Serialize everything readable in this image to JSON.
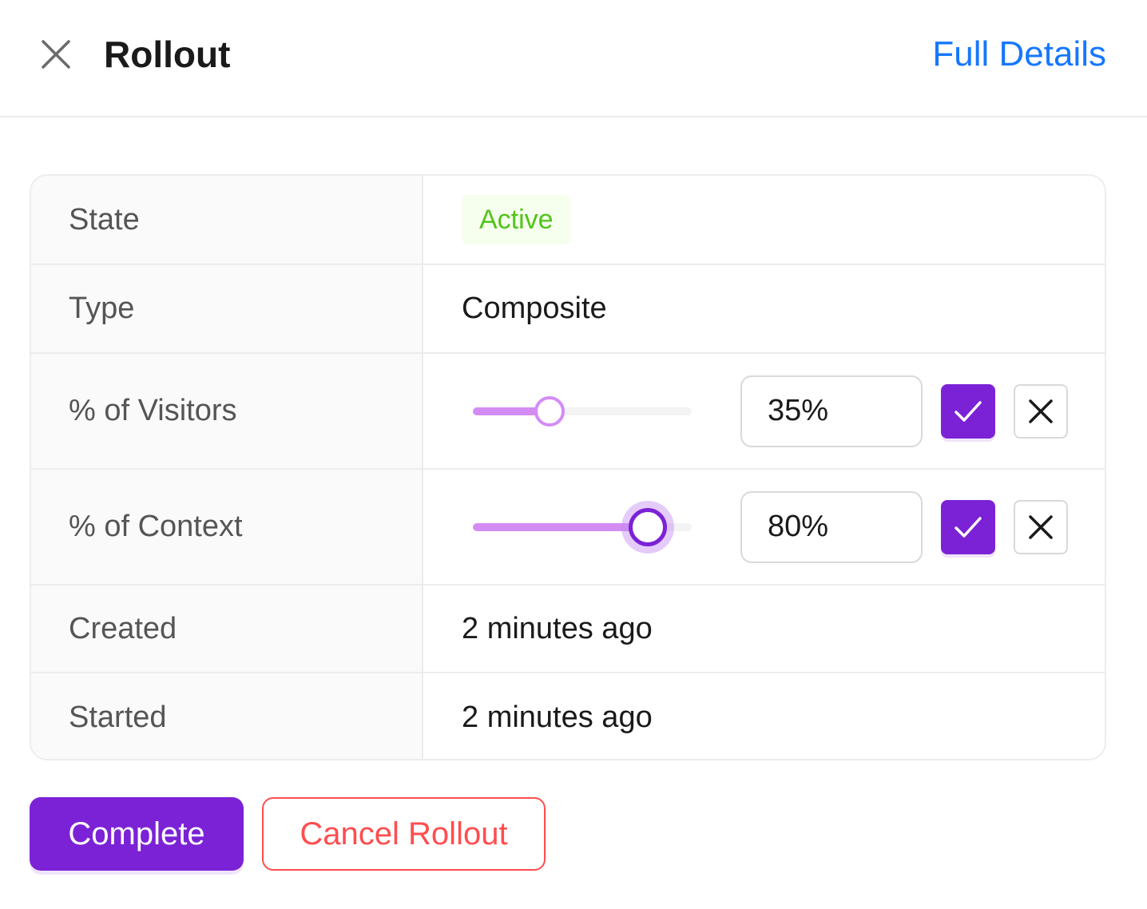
{
  "header": {
    "title": "Rollout",
    "full_details_link": "Full Details",
    "close_icon": "close-icon"
  },
  "table": {
    "state": {
      "label": "State",
      "value": "Active"
    },
    "type": {
      "label": "Type",
      "value": "Composite"
    },
    "visitors": {
      "label": "% of Visitors",
      "value_percent": 35,
      "input_value": "35%"
    },
    "context": {
      "label": "% of Context",
      "value_percent": 80,
      "input_value": "80%"
    },
    "created": {
      "label": "Created",
      "value": "2 minutes ago"
    },
    "started": {
      "label": "Started",
      "value": "2 minutes ago"
    }
  },
  "actions": {
    "complete_label": "Complete",
    "cancel_label": "Cancel Rollout"
  },
  "colors": {
    "brand_purple": "#7b22d6",
    "slider_light_purple": "#d48cf5",
    "link_blue": "#1677ff",
    "active_green": "#52c41a",
    "danger_red": "#ff4d4f"
  },
  "icons": {
    "confirm": "check-icon",
    "reset": "close-icon"
  }
}
